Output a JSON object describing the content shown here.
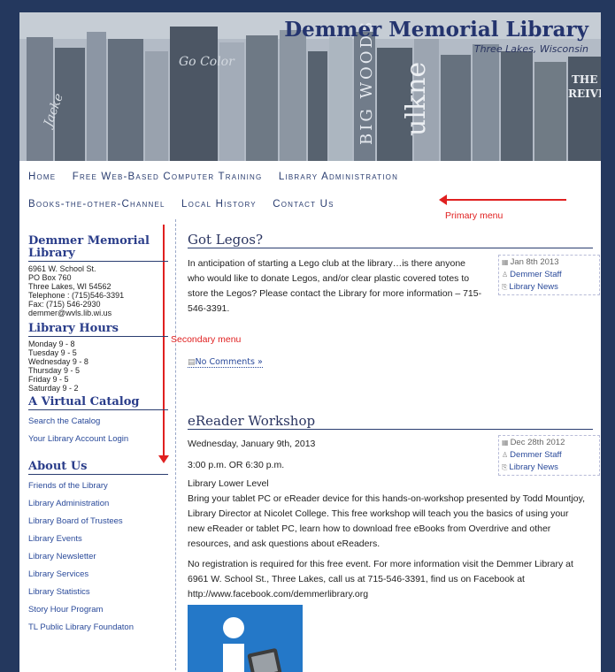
{
  "site": {
    "title": "Demmer Memorial Library",
    "tagline": "Three Lakes, Wisconsin"
  },
  "menu": {
    "primary_row1": [
      "Home",
      "Free Web-Based Computer Training",
      "Library Administration"
    ],
    "primary_row2": [
      "Books-the-other-Channel",
      "Local History",
      "Contact Us"
    ]
  },
  "annotations": {
    "primary": "Primary menu",
    "secondary": "Secondary menu"
  },
  "sidebar": {
    "library_heading": "Demmer Memorial Library",
    "address": [
      "6961 W. School St.",
      "PO Box 760",
      "Three Lakes, WI 54562",
      "Telephone : (715)546-3391",
      "Fax: (715) 546-2930",
      "demmer@wvls.lib.wi.us"
    ],
    "hours_heading": "Library Hours",
    "hours": [
      "Monday 9 - 8",
      "Tuesday 9 - 5",
      "Wednesday 9 - 8",
      "Thursday 9 - 5",
      "Friday 9 - 5",
      "Saturday 9 - 2"
    ],
    "catalog_heading": "A Virtual Catalog",
    "catalog_links": [
      "Search the Catalog",
      "Your Library Account Login"
    ],
    "about_heading": "About Us",
    "about_links": [
      "Friends of the Library",
      "Library Administration",
      "Library Board of Trustees",
      "Library Events",
      "Library Newsletter",
      "Library Services",
      "Library Statistics",
      "Story Hour Program",
      "TL Public Library Foundaton"
    ]
  },
  "posts": [
    {
      "title": "Got Legos?",
      "body": "In anticipation of starting a Lego club at the library…is there anyone who would like to donate Legos, and/or clear plastic covered totes to store the Legos?  Please contact the Library for more information – 715-546-3391.",
      "date": "Jan 8th 2013",
      "author": "Demmer Staff",
      "category": "Library News",
      "comments": "No Comments »"
    },
    {
      "title": "eReader Workshop",
      "line1": "Wednesday, January 9th, 2013",
      "line2": "3:00 p.m. OR 6:30 p.m.",
      "line3": "Library Lower Level",
      "para1": "Bring your tablet PC or eReader device for this hands-on-workshop presented by Todd Mountjoy, Library Director at Nicolet College.  This free workshop will teach you the basics of using your new eReader or tablet PC, learn how to download free eBooks from Overdrive and other resources, and ask questions about eReaders.",
      "para2": "No registration is required for this free event.  For more information visit the Demmer Library at 6961 W. School St., Three Lakes, call us at 715-546-3391, find us on Facebook at http://www.facebook.com/demmerlibrary.org",
      "date": "Dec 28th 2012",
      "author": "Demmer Staff",
      "category": "Library News"
    }
  ],
  "colors": {
    "frame": "#24385e",
    "heading": "#2a3d8a",
    "link": "#2a4a9a",
    "annotation": "#e02020"
  }
}
